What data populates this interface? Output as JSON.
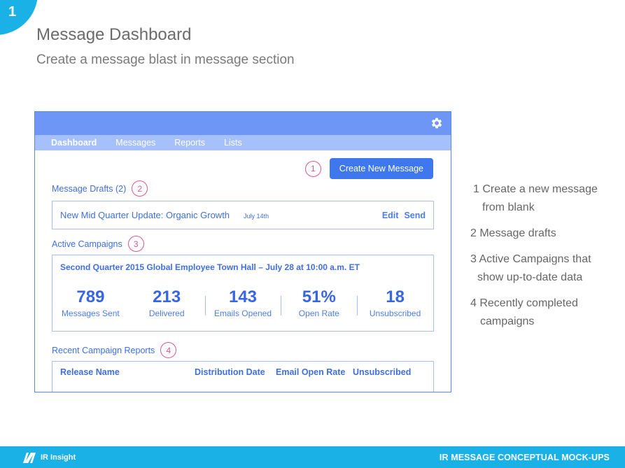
{
  "page_number": "1",
  "slide": {
    "title": "Message Dashboard",
    "subtitle": "Create a message blast in message section"
  },
  "mockup": {
    "nav": [
      "Dashboard",
      "Messages",
      "Reports",
      "Lists"
    ],
    "markers": {
      "create": "1",
      "drafts": "2",
      "campaigns": "3",
      "reports": "4"
    },
    "create_button": "Create New Message",
    "drafts": {
      "label": "Message Drafts (2)",
      "item_title": "New Mid Quarter Update: Organic Growth",
      "item_date": "July 14th",
      "edit": "Edit",
      "send": "Send"
    },
    "campaigns": {
      "label": "Active Campaigns",
      "title": "Second Quarter 2015 Global Employee Town Hall – July 28 at 10:00 a.m. ET",
      "stats": [
        {
          "value": "789",
          "label": "Messages Sent"
        },
        {
          "value": "213",
          "label": "Delivered"
        },
        {
          "value": "143",
          "label": "Emails Opened"
        },
        {
          "value": "51%",
          "label": "Open Rate"
        },
        {
          "value": "18",
          "label": "Unsubscribed"
        }
      ]
    },
    "reports": {
      "label": "Recent Campaign Reports",
      "columns": [
        "Release Name",
        "Distribution Date",
        "Email Open Rate",
        "Unsubscribed"
      ]
    }
  },
  "notes": [
    {
      "line1": "1 Create a new message",
      "line2": "from blank"
    },
    {
      "line1": "2 Message drafts",
      "line2": ""
    },
    {
      "line1": "3 Active Campaigns that",
      "line2": "show up-to-date data"
    },
    {
      "line1": "4 Recently completed",
      "line2": "campaigns"
    }
  ],
  "footer": {
    "brand": "IR Insight",
    "title": "IR MESSAGE CONCEPTUAL MOCK-UPS"
  },
  "colors": {
    "accent": "#19b1e6",
    "primary_blue": "#3f77ee",
    "topbar": "#6e96f6",
    "navbar": "#a5c0fb",
    "marker_pink": "#e0558a"
  }
}
